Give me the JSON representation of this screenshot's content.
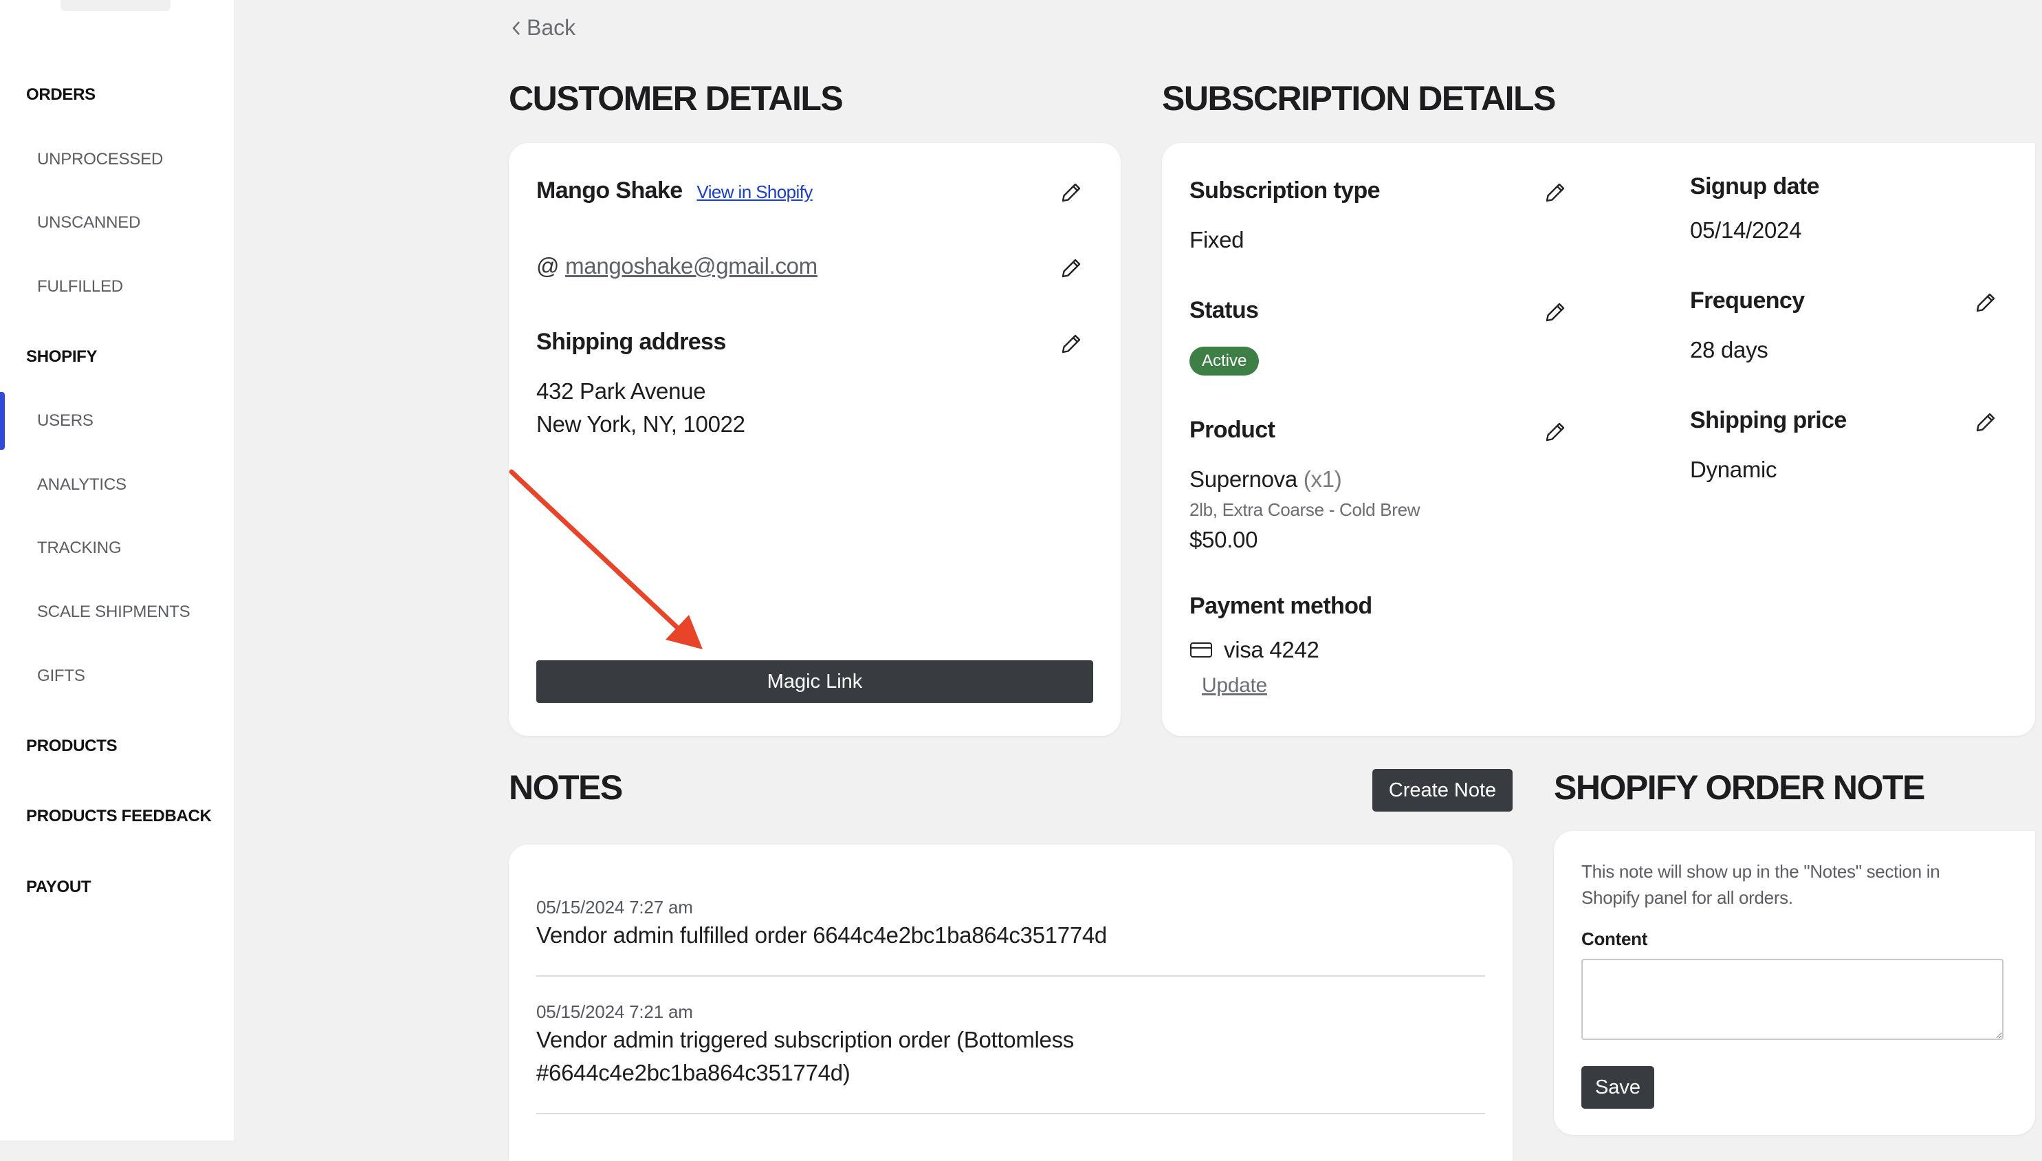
{
  "sidebar": {
    "items": [
      {
        "label": "ORDERS",
        "kind": "section"
      },
      {
        "label": "UNPROCESSED",
        "kind": "sub"
      },
      {
        "label": "UNSCANNED",
        "kind": "sub"
      },
      {
        "label": "FULFILLED",
        "kind": "sub"
      },
      {
        "label": "SHOPIFY",
        "kind": "section"
      },
      {
        "label": "USERS",
        "kind": "sub",
        "active": true
      },
      {
        "label": "ANALYTICS",
        "kind": "sub"
      },
      {
        "label": "TRACKING",
        "kind": "sub"
      },
      {
        "label": "SCALE SHIPMENTS",
        "kind": "sub"
      },
      {
        "label": "GIFTS",
        "kind": "sub"
      },
      {
        "label": "PRODUCTS",
        "kind": "section"
      },
      {
        "label": "PRODUCTS FEEDBACK",
        "kind": "section"
      },
      {
        "label": "PAYOUT",
        "kind": "section"
      }
    ],
    "accent_color": "#2f4bd8"
  },
  "back_label": "Back",
  "customer": {
    "title": "CUSTOMER DETAILS",
    "name": "Mango Shake",
    "view_link": "View in Shopify",
    "email_prefix": "@",
    "email": "mangoshake@gmail.com",
    "shipping_label": "Shipping address",
    "address_line1": "432 Park Avenue",
    "address_line2": "New York, NY, 10022",
    "magic_link_label": "Magic Link"
  },
  "subscription": {
    "title": "SUBSCRIPTION DETAILS",
    "type_label": "Subscription type",
    "type_value": "Fixed",
    "status_label": "Status",
    "status_value": "Active",
    "status_color": "#3d7f45",
    "product_label": "Product",
    "product_name": "Supernova",
    "product_qty": "(x1)",
    "product_variant": "2lb, Extra Coarse - Cold Brew",
    "product_price": "$50.00",
    "payment_label": "Payment method",
    "payment_value": "visa 4242",
    "update_label": "Update",
    "signup_label": "Signup date",
    "signup_value": "05/14/2024",
    "frequency_label": "Frequency",
    "frequency_value": "28 days",
    "shipping_price_label": "Shipping price",
    "shipping_price_value": "Dynamic"
  },
  "notes": {
    "title": "NOTES",
    "create_label": "Create Note",
    "entries": [
      {
        "date": "05/15/2024 7:27 am",
        "text": "Vendor admin fulfilled order 6644c4e2bc1ba864c351774d"
      },
      {
        "date": "05/15/2024 7:21 am",
        "text": "Vendor admin triggered subscription order (Bottomless #6644c4e2bc1ba864c351774d)"
      }
    ]
  },
  "order_note": {
    "title": "SHOPIFY ORDER NOTE",
    "description": "This note will show up in the \"Notes\" section in Shopify panel for all orders.",
    "content_label": "Content",
    "content_value": "",
    "save_label": "Save"
  },
  "annotation_color": "#e8442a",
  "icons": [
    "pencil-icon",
    "credit-card-icon",
    "chevron-left-icon",
    "arrow-annotation"
  ]
}
